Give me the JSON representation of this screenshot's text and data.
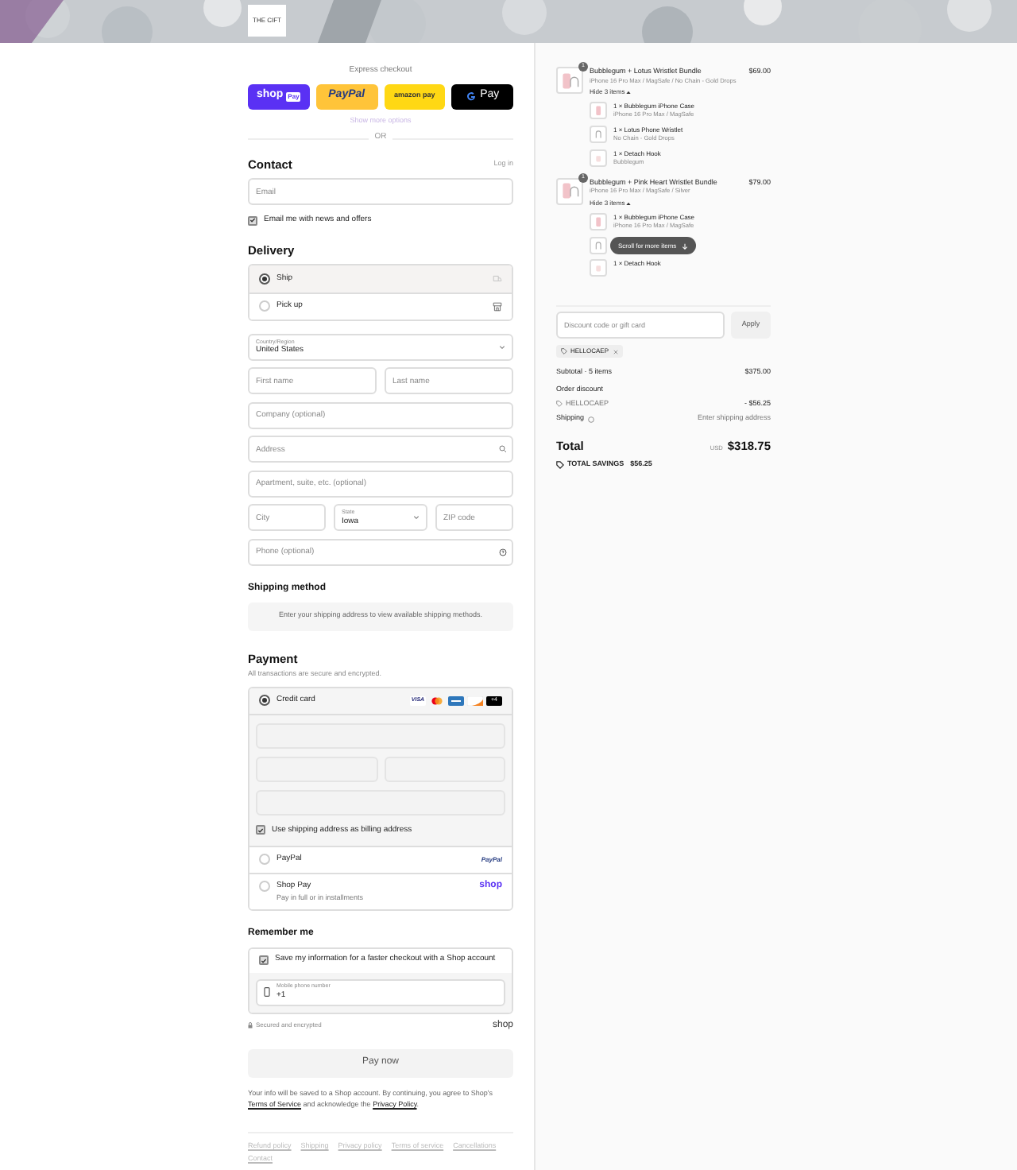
{
  "header": {
    "logo": "THE CIFT"
  },
  "express": {
    "title": "Express checkout",
    "buttons": [
      {
        "kind": "shop",
        "label": "shop",
        "badge": "Pay"
      },
      {
        "kind": "paypal",
        "label": "PayPal"
      },
      {
        "kind": "amazon",
        "label": "amazon pay"
      },
      {
        "kind": "gpay",
        "label": "Pay"
      }
    ],
    "more": "Show more options",
    "or": "OR"
  },
  "contact": {
    "title": "Contact",
    "login": "Log in",
    "email_placeholder": "Email",
    "newsletter": {
      "label": "Email me with news and offers",
      "checked": true
    }
  },
  "delivery": {
    "title": "Delivery",
    "options": [
      {
        "label": "Ship",
        "selected": true,
        "kind": "ship"
      },
      {
        "label": "Pick up",
        "selected": false,
        "kind": "pickup"
      }
    ],
    "rows": [
      [
        {
          "kind": "select",
          "label": "Country/Region",
          "value": "United States"
        }
      ],
      [
        {
          "kind": "input",
          "placeholder": "First name"
        },
        {
          "kind": "input",
          "placeholder": "Last name"
        }
      ],
      [
        {
          "kind": "input",
          "placeholder": "Company (optional)"
        }
      ],
      [
        {
          "kind": "search",
          "placeholder": "Address"
        }
      ],
      [
        {
          "kind": "input",
          "placeholder": "Apartment, suite, etc. (optional)"
        }
      ],
      [
        {
          "kind": "input",
          "placeholder": "City"
        },
        {
          "kind": "select",
          "label": "State",
          "value": "Iowa"
        },
        {
          "kind": "input",
          "placeholder": "ZIP code"
        }
      ],
      [
        {
          "kind": "help",
          "placeholder": "Phone (optional)"
        }
      ]
    ]
  },
  "shipping_method": {
    "title": "Shipping method",
    "message": "Enter your shipping address to view available shipping methods."
  },
  "payment": {
    "title": "Payment",
    "subtitle": "All transactions are secure and encrypted.",
    "methods": [
      {
        "kind": "card",
        "label": "Credit card",
        "selected": true,
        "brands": [
          {
            "kind": "visa",
            "label": "VISA"
          },
          {
            "kind": "mastercard"
          },
          {
            "kind": "amex"
          },
          {
            "kind": "discover"
          },
          {
            "kind": "more",
            "label": "+4"
          }
        ],
        "billing": {
          "label": "Use shipping address as billing address",
          "checked": true
        }
      },
      {
        "kind": "paypal",
        "label": "PayPal",
        "selected": false,
        "logo": "PayPal"
      },
      {
        "kind": "shoppay",
        "label": "Shop Pay",
        "selected": false,
        "sub": "Pay in full or in installments",
        "logo": "shop"
      }
    ]
  },
  "remember": {
    "title": "Remember me",
    "save": {
      "label": "Save my information for a faster checkout with a Shop account",
      "checked": true
    },
    "phone": {
      "label": "Mobile phone number",
      "value": "+1"
    },
    "secure": "Secured and encrypted",
    "brand": "shop"
  },
  "pay_button": "Pay now",
  "legal": [
    {
      "text": "Your info will be saved to a Shop account. By continuing, you agree to Shop's ",
      "link": false
    },
    {
      "text": "Terms of Service",
      "link": true
    },
    {
      "text": " and acknowledge the ",
      "link": false
    },
    {
      "text": "Privacy Policy",
      "link": true
    },
    {
      "text": ".",
      "link": false
    }
  ],
  "footer_links": [
    "Refund policy",
    "Shipping",
    "Privacy policy",
    "Terms of service",
    "Cancellations",
    "Contact"
  ],
  "summary": {
    "items": [
      {
        "qty": "1",
        "title": "Bubblegum + Lotus Wristlet Bundle",
        "variant": "iPhone 16 Pro Max / MagSafe / No Chain - Gold Drops",
        "price": "$69.00",
        "toggle": "Hide 3 items",
        "children": [
          {
            "kind": "case",
            "title": "1 × Bubblegum iPhone Case",
            "variant": "iPhone 16 Pro Max / MagSafe"
          },
          {
            "kind": "wristlet",
            "title": "1 × Lotus Phone Wristlet",
            "variant": "No Chain - Gold Drops"
          },
          {
            "kind": "hook",
            "title": "1 × Detach Hook",
            "variant": "Bubblegum"
          }
        ]
      },
      {
        "qty": "1",
        "title": "Bubblegum + Pink Heart Wristlet Bundle",
        "variant": "iPhone 16 Pro Max / MagSafe / Silver",
        "price": "$79.00",
        "toggle": "Hide 3 items",
        "children": [
          {
            "kind": "case",
            "title": "1 × Bubblegum iPhone Case",
            "variant": "iPhone 16 Pro Max / MagSafe"
          },
          {
            "kind": "wristlet"
          },
          {
            "kind": "hook",
            "title": "1 × Detach Hook"
          }
        ]
      }
    ],
    "scroll_hint": "Scroll for more items",
    "discount_placeholder": "Discount code or gift card",
    "apply": "Apply",
    "applied_code": "HELLOCAEP",
    "subtotal_label": "Subtotal · 5 items",
    "subtotal": "$375.00",
    "discount_label": "Order discount",
    "discount_code": "HELLOCAEP",
    "discount_amount": "- $56.25",
    "shipping_label": "Shipping",
    "shipping_value": "Enter shipping address",
    "total_label": "Total",
    "currency": "USD",
    "total": "$318.75",
    "savings_label": "TOTAL SAVINGS",
    "savings": "$56.25"
  }
}
